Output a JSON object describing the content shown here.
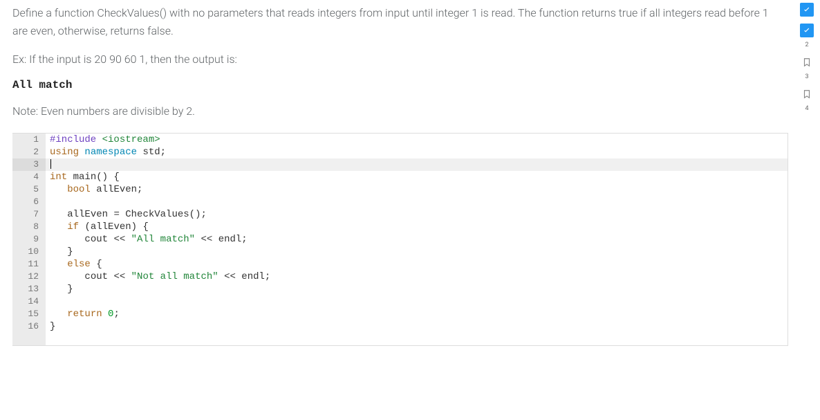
{
  "problem": {
    "instruction": "Define a function CheckValues() with no parameters that reads integers from input until integer 1 is read. The function returns true if all integers read before 1 are even, otherwise, returns false.",
    "example_label": "Ex: If the input is 20 90 60 1, then the output is:",
    "expected_output": "All match",
    "note": "Note: Even numbers are divisible by 2."
  },
  "editor": {
    "active_line": 3,
    "lines": [
      {
        "n": 1,
        "tokens": [
          {
            "t": "#include ",
            "c": "tok-pp"
          },
          {
            "t": "<iostream>",
            "c": "tok-inc"
          }
        ]
      },
      {
        "n": 2,
        "tokens": [
          {
            "t": "using ",
            "c": "tok-kw"
          },
          {
            "t": "namespace ",
            "c": "tok-ns"
          },
          {
            "t": "std",
            "c": "tok-id"
          },
          {
            "t": ";",
            "c": "tok-punct"
          }
        ]
      },
      {
        "n": 3,
        "tokens": []
      },
      {
        "n": 4,
        "tokens": [
          {
            "t": "int ",
            "c": "tok-type"
          },
          {
            "t": "main",
            "c": "tok-fn"
          },
          {
            "t": "() {",
            "c": "tok-punct"
          }
        ]
      },
      {
        "n": 5,
        "tokens": [
          {
            "t": "   ",
            "c": ""
          },
          {
            "t": "bool ",
            "c": "tok-type"
          },
          {
            "t": "allEven",
            "c": "tok-id"
          },
          {
            "t": ";",
            "c": "tok-punct"
          }
        ]
      },
      {
        "n": 6,
        "tokens": []
      },
      {
        "n": 7,
        "tokens": [
          {
            "t": "   ",
            "c": ""
          },
          {
            "t": "allEven ",
            "c": "tok-id"
          },
          {
            "t": "= ",
            "c": "tok-punct"
          },
          {
            "t": "CheckValues",
            "c": "tok-fn"
          },
          {
            "t": "();",
            "c": "tok-punct"
          }
        ]
      },
      {
        "n": 8,
        "tokens": [
          {
            "t": "   ",
            "c": ""
          },
          {
            "t": "if ",
            "c": "tok-kw"
          },
          {
            "t": "(",
            "c": "tok-punct"
          },
          {
            "t": "allEven",
            "c": "tok-id"
          },
          {
            "t": ") {",
            "c": "tok-punct"
          }
        ]
      },
      {
        "n": 9,
        "tokens": [
          {
            "t": "      ",
            "c": ""
          },
          {
            "t": "cout ",
            "c": "tok-id"
          },
          {
            "t": "<< ",
            "c": "tok-punct"
          },
          {
            "t": "\"All match\"",
            "c": "tok-str"
          },
          {
            "t": " << ",
            "c": "tok-punct"
          },
          {
            "t": "endl",
            "c": "tok-id"
          },
          {
            "t": ";",
            "c": "tok-punct"
          }
        ]
      },
      {
        "n": 10,
        "tokens": [
          {
            "t": "   ",
            "c": ""
          },
          {
            "t": "}",
            "c": "tok-punct"
          }
        ]
      },
      {
        "n": 11,
        "tokens": [
          {
            "t": "   ",
            "c": ""
          },
          {
            "t": "else ",
            "c": "tok-kw"
          },
          {
            "t": "{",
            "c": "tok-punct"
          }
        ]
      },
      {
        "n": 12,
        "tokens": [
          {
            "t": "      ",
            "c": ""
          },
          {
            "t": "cout ",
            "c": "tok-id"
          },
          {
            "t": "<< ",
            "c": "tok-punct"
          },
          {
            "t": "\"Not all match\"",
            "c": "tok-str"
          },
          {
            "t": " << ",
            "c": "tok-punct"
          },
          {
            "t": "endl",
            "c": "tok-id"
          },
          {
            "t": ";",
            "c": "tok-punct"
          }
        ]
      },
      {
        "n": 13,
        "tokens": [
          {
            "t": "   ",
            "c": ""
          },
          {
            "t": "}",
            "c": "tok-punct"
          }
        ]
      },
      {
        "n": 14,
        "tokens": []
      },
      {
        "n": 15,
        "tokens": [
          {
            "t": "   ",
            "c": ""
          },
          {
            "t": "return ",
            "c": "tok-kw"
          },
          {
            "t": "0",
            "c": "tok-num"
          },
          {
            "t": ";",
            "c": "tok-punct"
          }
        ]
      },
      {
        "n": 16,
        "tokens": [
          {
            "t": "}",
            "c": "tok-punct"
          }
        ]
      }
    ]
  },
  "progress": {
    "steps": [
      {
        "id": 1,
        "state": "done-partial"
      },
      {
        "id": 2,
        "state": "done",
        "label": "2"
      },
      {
        "id": 3,
        "state": "current",
        "label": "3"
      },
      {
        "id": 4,
        "state": "pending",
        "label": "4"
      }
    ]
  }
}
